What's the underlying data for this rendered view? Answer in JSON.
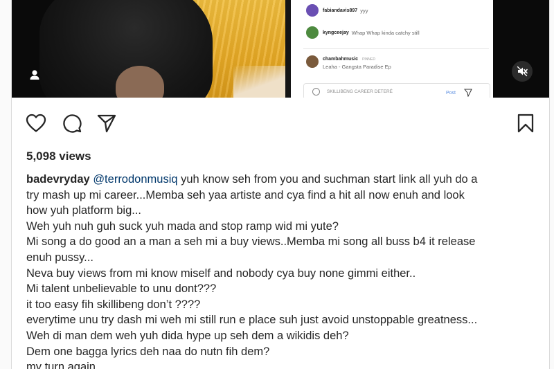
{
  "media": {
    "comments": [
      {
        "username": "fabiandavis897",
        "text": "yyy",
        "avatar_color": "#6a4fb3"
      },
      {
        "username": "kyngceejay",
        "text": "Whap Whap kinda catchy still",
        "avatar_color": "#4d8a3f"
      },
      {
        "username": "chambahmusic",
        "badge": "PINNED",
        "text": "Leaha - Gangsta Paradise Ep",
        "avatar_color": "#7a5a3c"
      }
    ],
    "comment_input_text": "SKILLIBENG CAREER DETERÉ",
    "post_label": "Post"
  },
  "views_text": "5,098 views",
  "caption": {
    "author": "badevryday",
    "mention": "@terrodonmusiq",
    "first_line_rest": " yuh know seh from you and suchman start link all yuh do a",
    "lines": [
      "try mash up mi career...Memba seh yaa artiste and cya find a hit all now enuh and look",
      "how yuh platform big...",
      "Weh yuh nuh guh suck yuh mada and stop ramp wid mi yute?",
      "Mi song a do good an a man a seh mi a buy views..Memba mi song all buss b4 it release",
      "enuh pussy...",
      "Neva buy views from mi know miself and nobody cya buy none gimmi either..",
      "Mi talent unbelievable to unu dont???",
      "it too easy fih skillibeng don’t ????",
      "everytime unu try dash mi weh mi still run e place suh just avoid unstoppable greatness...",
      "Weh di man dem weh yuh dida hype up seh dem a wikidis deh?",
      "Dem one bagga lyrics deh naa do nutn fih dem?",
      "my turn again"
    ]
  },
  "colors": {
    "text": "#262626",
    "mention": "#00376b",
    "curtain": "#e8aa25"
  },
  "icons": [
    "person-icon",
    "mute-icon",
    "heart-icon",
    "comment-icon",
    "share-icon",
    "bookmark-icon",
    "send-icon"
  ]
}
